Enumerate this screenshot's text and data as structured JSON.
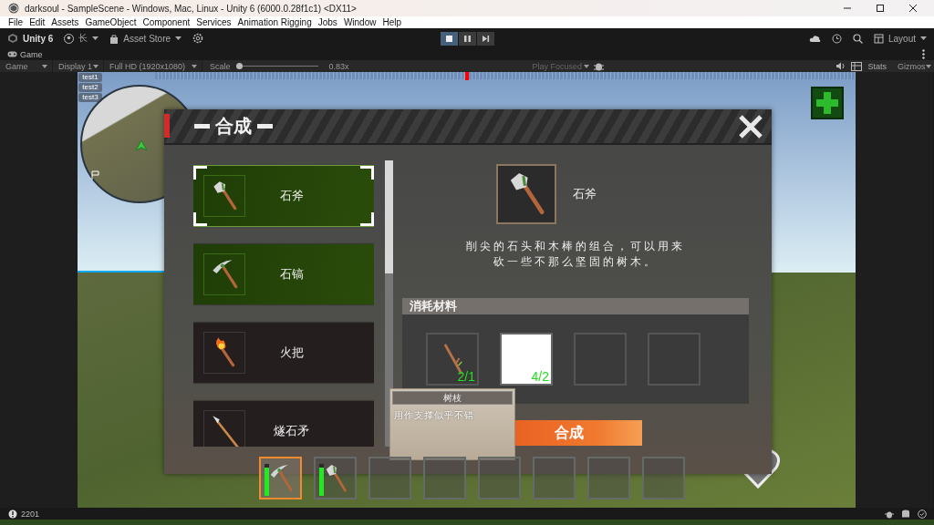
{
  "window": {
    "title": "darksoul - SampleScene - Windows, Mac, Linux - Unity 6 (6000.0.28f1c1) <DX11>"
  },
  "menu": [
    "File",
    "Edit",
    "Assets",
    "GameObject",
    "Component",
    "Services",
    "Animation Rigging",
    "Jobs",
    "Window",
    "Help"
  ],
  "toolbar": {
    "product": "Unity 6",
    "account": "长",
    "asset_store": "Asset Store",
    "play_controls": [
      {
        "kind": "play",
        "selected": true
      },
      {
        "kind": "pause",
        "selected": false
      },
      {
        "kind": "step",
        "selected": false
      }
    ],
    "layout": "Layout"
  },
  "game_tab": {
    "label": "Game"
  },
  "game_toolbar": {
    "view": "Game",
    "display": "Display 1",
    "resolution": "Full HD (1920x1080)",
    "scale_label": "Scale",
    "scale": {
      "level": 0.02
    },
    "scale_value": "0.83x",
    "play_mode": "Play Focused",
    "stats": "Stats",
    "gizmos": "Gizmos"
  },
  "hud": {
    "debug_buttons": [
      "test1",
      "test2",
      "test3"
    ]
  },
  "crafting": {
    "title": "合成",
    "recipes": [
      {
        "name": "石斧",
        "kind": "axe",
        "selected": true,
        "craftable": true
      },
      {
        "name": "石镐",
        "kind": "pickaxe",
        "selected": false,
        "craftable": true
      },
      {
        "name": "火把",
        "kind": "torch",
        "selected": false,
        "craftable": false
      },
      {
        "name": "燧石矛",
        "kind": "spear",
        "selected": false,
        "craftable": false
      }
    ],
    "detail": {
      "kind": "axe",
      "name": "石斧",
      "description": "削尖的石头和木棒的组合，可以用来砍一些不那么坚固的树木。"
    },
    "materials_title": "消耗材料",
    "materials": [
      {
        "kind": "stick",
        "count": "2/1"
      },
      {
        "kind": "blank",
        "count": "4/2"
      },
      {
        "kind": "empty"
      },
      {
        "kind": "empty"
      }
    ],
    "craft_button": "合成",
    "tooltip": {
      "title": "树枝",
      "text": "用作支撑似乎不错"
    }
  },
  "hotbar": [
    {
      "kind": "pickaxe",
      "selected": true,
      "level": 0.9
    },
    {
      "kind": "axe",
      "selected": false,
      "level": 0.9
    },
    {
      "kind": "empty",
      "selected": false
    },
    {
      "kind": "empty",
      "selected": false
    },
    {
      "kind": "empty",
      "selected": false
    },
    {
      "kind": "empty",
      "selected": false
    },
    {
      "kind": "empty",
      "selected": false
    },
    {
      "kind": "empty",
      "selected": false
    }
  ],
  "status_bar": {
    "text": "2201"
  }
}
